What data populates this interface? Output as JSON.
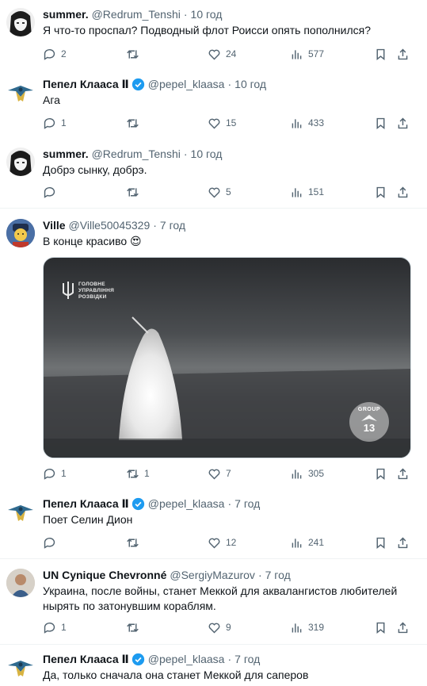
{
  "tweets": [
    {
      "name": "summer.",
      "handle": "@Redrum_Tenshi",
      "time": "10 год",
      "verified": false,
      "text": "Я что-то проспал? Подводный флот Роисси опять пополнился?",
      "replies": "2",
      "retweets": "",
      "likes": "24",
      "views": "577"
    },
    {
      "name": "Пепел Клааса Ⅱ",
      "handle": "@pepel_klaasa",
      "time": "10 год",
      "verified": true,
      "text": "Ага",
      "replies": "1",
      "retweets": "",
      "likes": "15",
      "views": "433"
    },
    {
      "name": "summer.",
      "handle": "@Redrum_Tenshi",
      "time": "10 год",
      "verified": false,
      "text": "Добрэ сынку, добрэ.",
      "replies": "",
      "retweets": "",
      "likes": "5",
      "views": "151"
    },
    {
      "name": "Ville",
      "handle": "@Ville50045329",
      "time": "7 год",
      "verified": false,
      "text": "В конце красиво 😍",
      "replies": "1",
      "retweets": "1",
      "likes": "7",
      "views": "305",
      "media": {
        "watermark_line1": "ГОЛОВНЕ",
        "watermark_line2": "УПРАВЛІННЯ",
        "watermark_line3": "РОЗВІДКИ",
        "badge_top": "GROUP",
        "badge_number": "13"
      }
    },
    {
      "name": "Пепел Клааса Ⅱ",
      "handle": "@pepel_klaasa",
      "time": "7 год",
      "verified": true,
      "text": "Поет Селин Дион",
      "replies": "",
      "retweets": "",
      "likes": "12",
      "views": "241"
    },
    {
      "name": "UN Cynique Chevronné",
      "handle": "@SergiyMazurov",
      "time": "7 год",
      "verified": false,
      "text": "Украина, после войны, станет Меккой для аквалангистов любителей нырять по затонувшим кораблям.",
      "replies": "1",
      "retweets": "",
      "likes": "9",
      "views": "319"
    },
    {
      "name": "Пепел Клааса Ⅱ",
      "handle": "@pepel_klaasa",
      "time": "7 год",
      "verified": true,
      "text": "Да, только сначала она станет Меккой для саперов",
      "replies": "",
      "retweets": "",
      "likes": "",
      "views": ""
    }
  ],
  "colors": {
    "text": "#0f1419",
    "secondary": "#536471",
    "verified": "#1d9bf0",
    "separator": "#eff3f4"
  }
}
